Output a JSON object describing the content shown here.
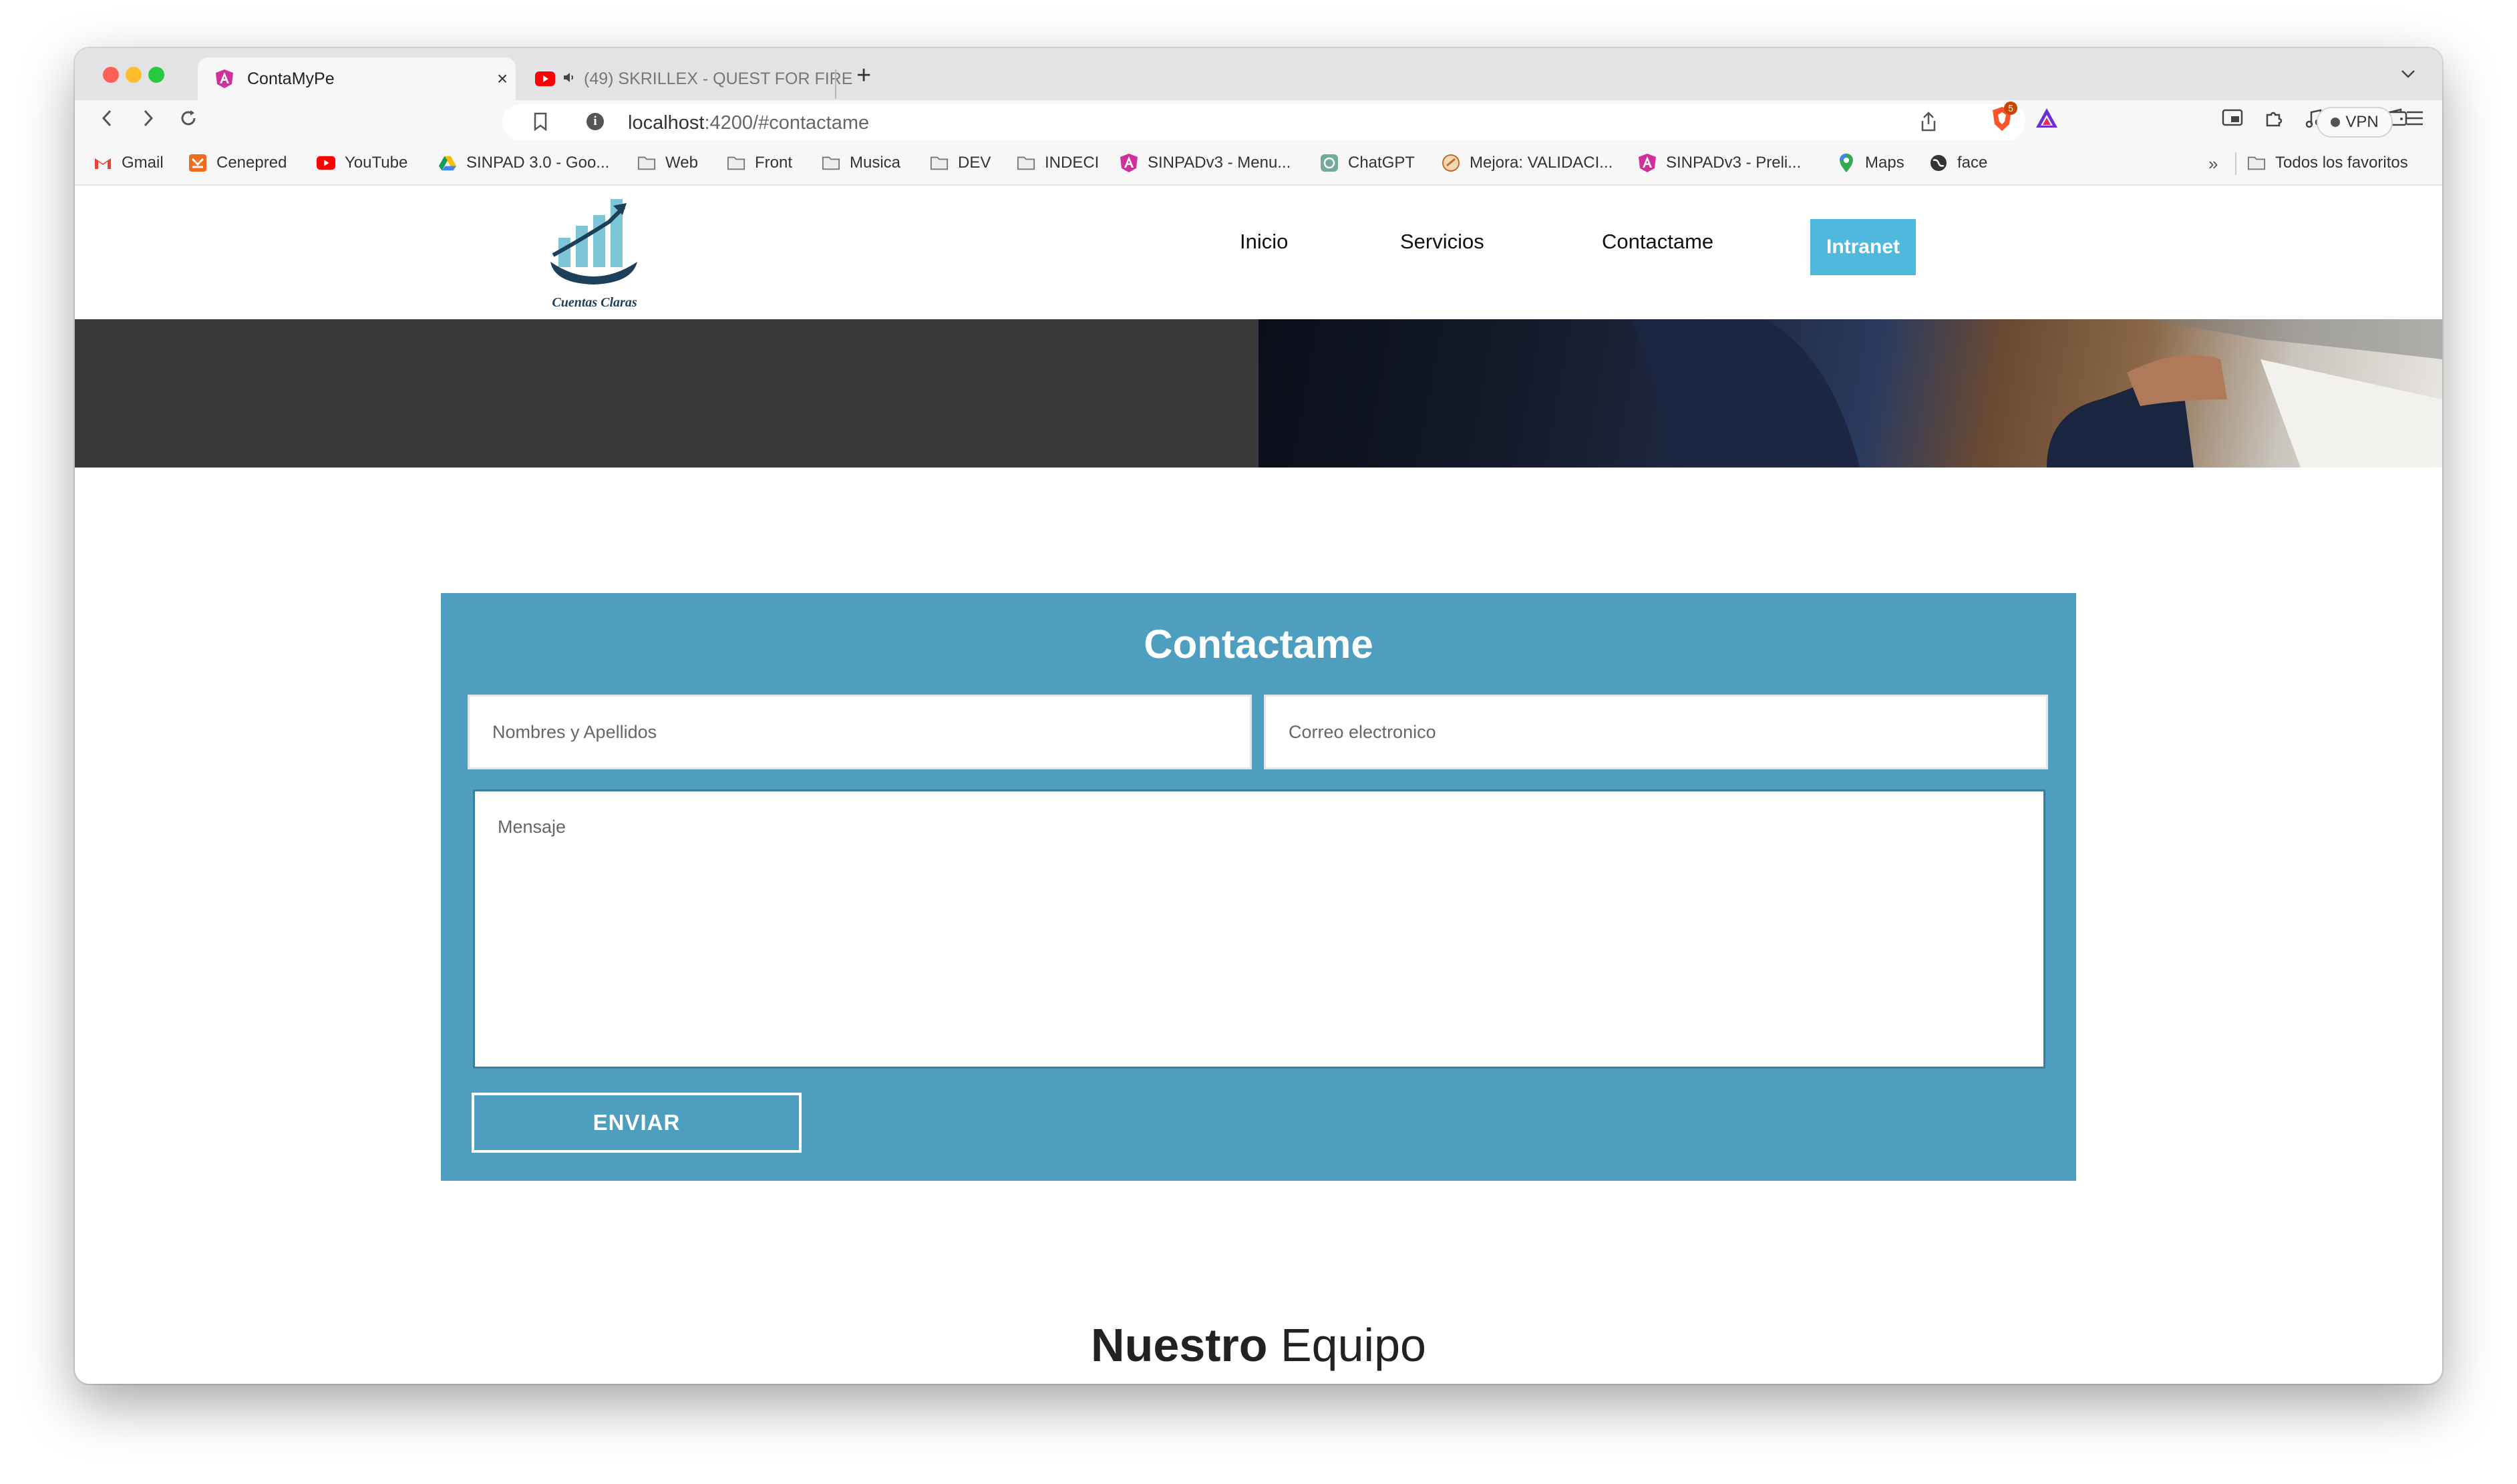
{
  "browser": {
    "tabs": [
      {
        "title": "ContaMyPe",
        "active": true
      },
      {
        "title": "(49) SKRILLEX - QUEST FOR FIRE",
        "active": false
      }
    ],
    "url_host": "localhost",
    "url_path": ":4200/#contactame",
    "vpn_label": "VPN",
    "brave_badge": "5",
    "bookmarks": [
      {
        "label": "Gmail",
        "icon": "gmail-icon"
      },
      {
        "label": "Cenepred",
        "icon": "cenepred-icon"
      },
      {
        "label": "YouTube",
        "icon": "youtube-icon"
      },
      {
        "label": "SINPAD 3.0 - Goo...",
        "icon": "drive-icon"
      },
      {
        "label": "Web",
        "icon": "folder-icon"
      },
      {
        "label": "Front",
        "icon": "folder-icon"
      },
      {
        "label": "Musica",
        "icon": "folder-icon"
      },
      {
        "label": "DEV",
        "icon": "folder-icon"
      },
      {
        "label": "INDECI",
        "icon": "folder-icon"
      },
      {
        "label": "SINPADv3 - Menu...",
        "icon": "angular-icon"
      },
      {
        "label": "ChatGPT",
        "icon": "chatgpt-icon"
      },
      {
        "label": "Mejora: VALIDACI...",
        "icon": "mejora-icon"
      },
      {
        "label": "SINPADv3 - Preli...",
        "icon": "angular-icon"
      },
      {
        "label": "Maps",
        "icon": "maps-icon"
      },
      {
        "label": "face",
        "icon": "globe-icon"
      }
    ],
    "all_bookmarks": "Todos los favoritos",
    "more_bookmarks": "»"
  },
  "site": {
    "logo_text": "Cuentas Claras",
    "nav": {
      "inicio": "Inicio",
      "servicios": "Servicios",
      "contactame": "Contactame",
      "intranet": "Intranet"
    },
    "accent_color": "#4fb8dd",
    "panel_color": "#4e9ebf"
  },
  "contact": {
    "title": "Contactame",
    "name_placeholder": "Nombres y Apellidos",
    "email_placeholder": "Correo electronico",
    "message_placeholder": "Mensaje",
    "send_label": "ENVIAR"
  },
  "team": {
    "title_bold": "Nuestro",
    "title_rest": "Equipo"
  }
}
